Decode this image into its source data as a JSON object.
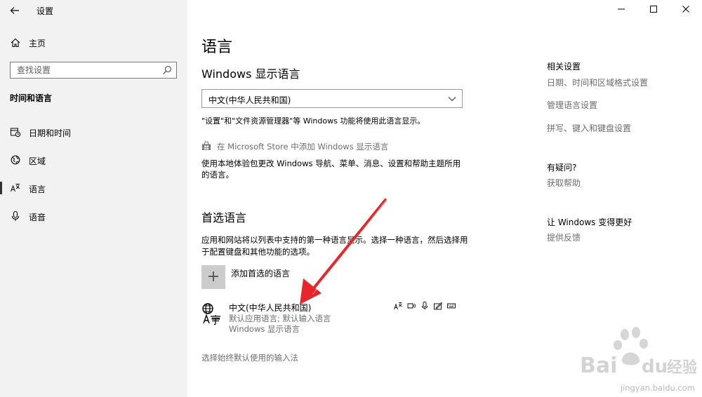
{
  "app": {
    "title": "设置"
  },
  "window": {
    "minimize": "—",
    "maximize": "☐",
    "close": "✕"
  },
  "sidebar": {
    "home_label": "主页",
    "search_placeholder": "查找设置",
    "section_heading": "时间和语言",
    "items": [
      {
        "label": "日期和时间",
        "icon": "calendar-clock-icon",
        "active": false
      },
      {
        "label": "区域",
        "icon": "globe-region-icon",
        "active": false
      },
      {
        "label": "语言",
        "icon": "language-icon",
        "active": true
      },
      {
        "label": "语音",
        "icon": "microphone-icon",
        "active": false
      }
    ]
  },
  "main": {
    "page_title": "语言",
    "display_language": {
      "heading": "Windows 显示语言",
      "selected": "中文(中华人民共和国)",
      "note": "\"设置\"和\"文件资源管理器\"等 Windows 功能将使用此语言显示。",
      "store_link": "在 Microsoft Store 中添加 Windows 显示语言",
      "local_experience": "使用本地体验包更改 Windows 导航、菜单、消息、设置和帮助主题所用的语言。"
    },
    "preferred_languages": {
      "heading": "首选语言",
      "description": "应用和网站将以列表中支持的第一种语言显示。选择一种语言，然后选择用于配置键盘和其他功能的选项。",
      "add_label": "添加首选的语言",
      "languages": [
        {
          "name": "中文(中华人民共和国)",
          "sub1": "默认应用语言; 默认输入语言",
          "sub2": "Windows 显示语言"
        }
      ]
    },
    "input_default_link": "选择始终默认使用的输入法"
  },
  "related": {
    "heading": "相关设置",
    "links": [
      "日期、时间和区域格式设置",
      "管理语言设置",
      "拼写、键入和键盘设置"
    ],
    "help_heading": "有疑问?",
    "help_link": "获取帮助",
    "improve_heading": "让 Windows 变得更好",
    "feedback_link": "提供反馈"
  },
  "watermark": {
    "brand": "Bai du 经验",
    "url": "jingyan.baidu.com"
  },
  "colors": {
    "sidebar_bg": "#f2f2f2",
    "secondary_text": "#6d6d6d",
    "arrow": "#e8252a"
  }
}
